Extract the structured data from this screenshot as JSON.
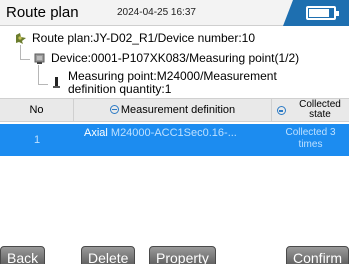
{
  "header": {
    "title": "Route plan",
    "datetime": "2024-04-25 16:37",
    "battery_level": 0.85
  },
  "tree": {
    "route": "Route plan:JY-D02_R1/Device number:10",
    "device": "Device:0001-P107XK083/Measuring point(1/2)",
    "point_line1": "Measuring point:M24000/Measurement",
    "point_line2": "definition quantity:1"
  },
  "table": {
    "columns": {
      "no": "No",
      "definition": "Measurement definition",
      "state_line1": "Collected",
      "state_line2": "state"
    },
    "rows": [
      {
        "no": "1",
        "direction": "Axial",
        "definition": "M24000-ACC1Sec0.16-...",
        "state_line1": "Collected 3",
        "state_line2": "times"
      }
    ]
  },
  "buttons": {
    "back": "Back",
    "delete": "Delete",
    "property": "Property",
    "confirm": "Confirm"
  },
  "colors": {
    "selection": "#1c8cf0",
    "accent": "#1e6fb0"
  }
}
